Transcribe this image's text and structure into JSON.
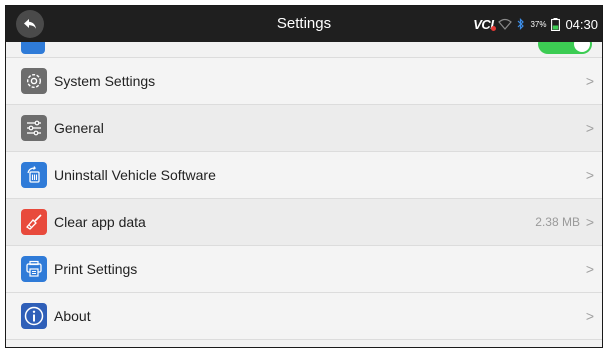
{
  "header": {
    "title": "Settings",
    "status": {
      "vci_label": "VCI",
      "battery_percent": "37%",
      "time": "04:30"
    }
  },
  "list": {
    "partial_item": {
      "toggle_on": true
    },
    "items": [
      {
        "label": "System Settings",
        "value": "",
        "icon": "gear-icon",
        "color": "#6d6d6d"
      },
      {
        "label": "General",
        "value": "",
        "icon": "sliders-icon",
        "color": "#6d6d6d"
      },
      {
        "label": "Uninstall Vehicle Software",
        "value": "",
        "icon": "uninstall-icon",
        "color": "#2f7bd8"
      },
      {
        "label": "Clear app data",
        "value": "2.38 MB",
        "icon": "broom-icon",
        "color": "#e84a3c"
      },
      {
        "label": "Print Settings",
        "value": "",
        "icon": "printer-icon",
        "color": "#2f7bd8"
      },
      {
        "label": "About",
        "value": "",
        "icon": "info-icon",
        "color": "#2f5fb8"
      }
    ]
  },
  "colors": {
    "header_bg": "#1f1f1f",
    "toggle_on": "#3ccc53",
    "row_bg": "#f4f4f4"
  }
}
